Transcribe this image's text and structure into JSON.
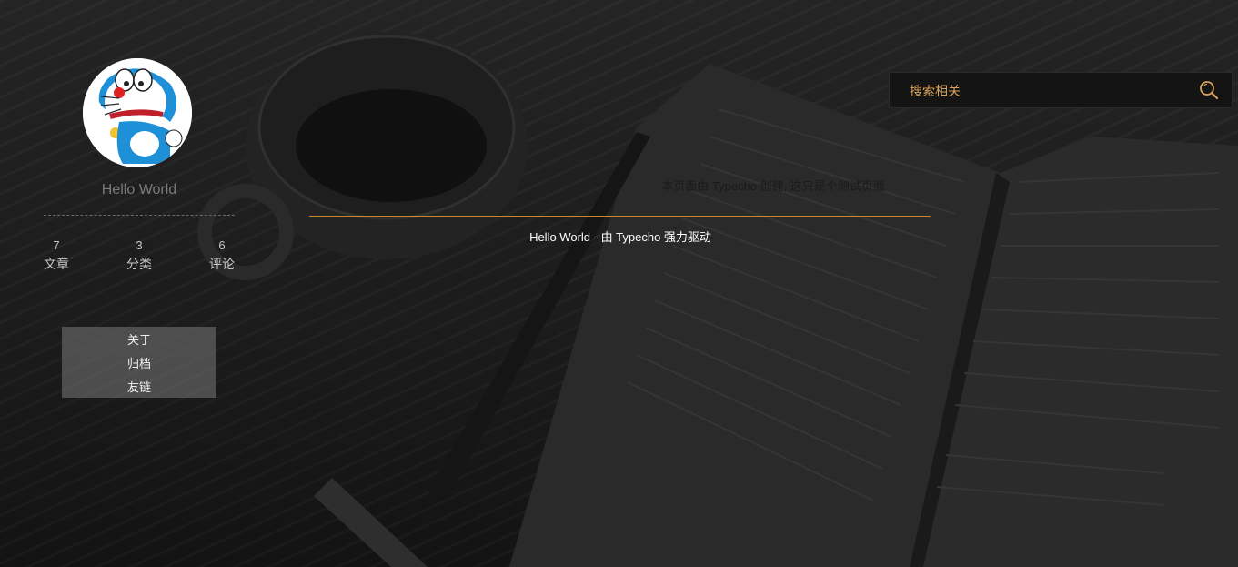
{
  "profile": {
    "site_name": "Hello World",
    "avatar_icon": "doraemon-avatar-icon"
  },
  "stats": [
    {
      "count": "7",
      "label": "文章"
    },
    {
      "count": "3",
      "label": "分类"
    },
    {
      "count": "6",
      "label": "评论"
    }
  ],
  "nav": {
    "items": [
      {
        "label": "关于"
      },
      {
        "label": "归档"
      },
      {
        "label": "友链"
      }
    ]
  },
  "search": {
    "placeholder": "搜索相关",
    "icon": "search-icon"
  },
  "main": {
    "tagline": "本页面由 Typecho 创建, 这只是个测试页面",
    "footer": "Hello World - 由 Typecho 强力驱动"
  },
  "colors": {
    "accent": "#c8872f",
    "search_text": "#d7a35a",
    "nav_bg": "#787878"
  }
}
